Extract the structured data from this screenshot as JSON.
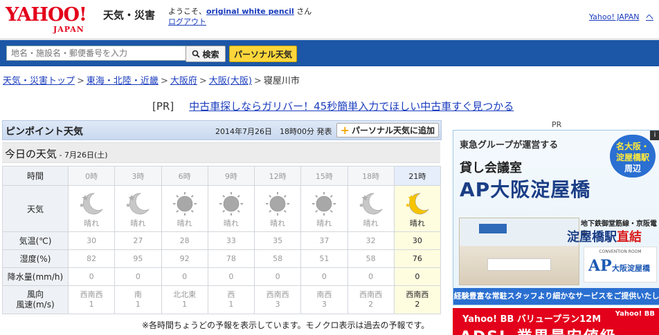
{
  "header": {
    "logo_main": "YAHOO!",
    "logo_sub": "JAPAN",
    "site_title": "天気・災害",
    "welcome_prefix": "ようこそ、",
    "username": "original white pencil",
    "welcome_suffix": " さん",
    "logout_label": "ログアウト",
    "top_links": [
      "Yahoo! JAPAN",
      "ヘ"
    ]
  },
  "search": {
    "placeholder": "地名・施設名・郵便番号を入力",
    "search_label": "検索",
    "personal_label": "パーソナル天気"
  },
  "breadcrumb": [
    "天気・災害トップ",
    "東海・北陸・近畿",
    "大阪府",
    "大阪(大阪)",
    "寝屋川市"
  ],
  "pr": {
    "tag": "[PR]",
    "text": "中古車探しならガリバー！45秒簡単入力でほしい中古車すぐ見つかる"
  },
  "forecast": {
    "title": "ピンポイント天気",
    "issued": "2014年7月26日　18時00分 発表",
    "add_button": "パーソナル天気に追加",
    "today_title": "今日の天気",
    "today_date": " - 7月26日(土)",
    "labels": {
      "time": "時間",
      "weather": "天気",
      "temp": "気温(℃)",
      "humidity": "湿度(%)",
      "precip": "降水量(mm/h)",
      "wind": "風向\n風速(m/s)"
    },
    "hours": [
      "0時",
      "3時",
      "6時",
      "9時",
      "12時",
      "15時",
      "18時",
      "21時"
    ],
    "weather": [
      "晴れ",
      "晴れ",
      "晴れ",
      "晴れ",
      "晴れ",
      "晴れ",
      "晴れ",
      "晴れ"
    ],
    "weather_icons": [
      "moon-icon",
      "moon-icon",
      "sun-icon",
      "sun-icon",
      "sun-icon",
      "sun-icon",
      "moon-icon",
      "moon-icon"
    ],
    "temp": [
      "30",
      "27",
      "28",
      "33",
      "35",
      "37",
      "32",
      "30"
    ],
    "humidity": [
      "82",
      "95",
      "92",
      "78",
      "58",
      "51",
      "58",
      "76"
    ],
    "precip": [
      "0",
      "0",
      "0",
      "0",
      "0",
      "0",
      "0",
      "0"
    ],
    "wind_dir": [
      "西南西",
      "南",
      "北北東",
      "西",
      "西南西",
      "南西",
      "西南西",
      "西南西"
    ],
    "wind_speed": [
      "1",
      "1",
      "1",
      "1",
      "3",
      "3",
      "2",
      "2"
    ],
    "current_index": 7,
    "note": "※各時間ちょうどの予報を表示しています。モノクロ表示は過去の予報です。"
  },
  "ad": {
    "pr_label": "PR",
    "corner": "i",
    "line1": "東急グループが運営する",
    "badge": [
      "名大阪・",
      "淀屋橋駅",
      "周辺"
    ],
    "line2": "貸し会議室",
    "line3": "AP大阪淀屋橋",
    "line4": "地下鉄御堂筋線・京阪電車",
    "line5a": "淀屋橋駅",
    "line5b": "直結",
    "logo_caption": "CONVENTION ROOM",
    "logo_ap": "AP",
    "logo_name": "大阪淀屋橋",
    "banner": "経験豊富な常駐スタッフより細かなサービスをご提供いたします"
  },
  "ad2": {
    "line1a": "Yahoo! BB バリュープラン12M",
    "brand": "Yahoo! BB",
    "line2": "ADSL 業界最安値級"
  }
}
